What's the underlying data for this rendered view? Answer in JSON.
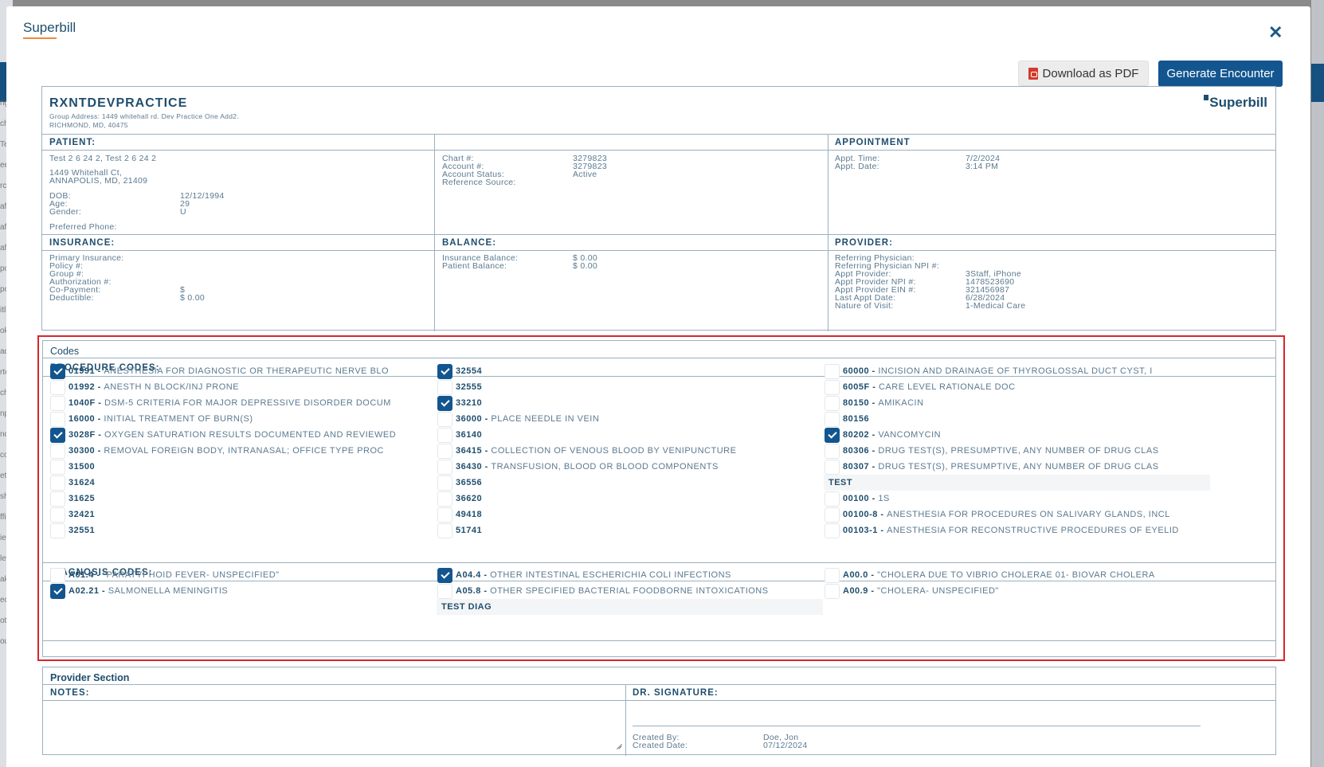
{
  "modal": {
    "title": "Superbill",
    "download_label": "Download as PDF",
    "generate_label": "Generate Encounter"
  },
  "bg": {
    "left_labels": [
      "ng",
      "chi,",
      "Tes",
      "eevi",
      "rco",
      "aff,",
      "aff,",
      "aff,",
      "pol",
      "pol",
      "itlis",
      "oke",
      "adi",
      "rte",
      "che",
      "npl",
      "ncel",
      "con",
      "ete",
      "sho",
      "ffir",
      "ient",
      "led",
      "ake",
      "eck",
      "otal",
      "oup"
    ]
  },
  "header": {
    "practice": "RXNTDEVPRACTICE",
    "address_line1": "Group Address: 1449 whitehall rd. Dev Practice One Add2.",
    "address_line2": "RICHMOND, MD, 40475",
    "logo": "Superbill"
  },
  "patient": {
    "heading": "PATIENT:",
    "name": "Test 2 6 24 2, Test 2 6 24 2",
    "street": "1449 Whitehall Ct,",
    "city": "ANNAPOLIS, MD, 21409",
    "dob_label": "DOB:",
    "dob": "12/12/1994",
    "age_label": "Age:",
    "age": "29",
    "gender_label": "Gender:",
    "gender": "U",
    "phone_label": "Preferred Phone:"
  },
  "account": {
    "chart_label": "Chart #:",
    "chart": "3279823",
    "account_label": "Account #:",
    "account": "3279823",
    "status_label": "Account Status:",
    "status": "Active",
    "ref_label": "Reference Source:"
  },
  "appointment": {
    "heading": "APPOINTMENT",
    "time_label": "Appt. Time:",
    "time": "7/2/2024",
    "date_label": "Appt. Date:",
    "date": "3:14 PM"
  },
  "insurance": {
    "heading": "INSURANCE:",
    "primary_label": "Primary Insurance:",
    "policy_label": "Policy #:",
    "group_label": "Group #:",
    "auth_label": "Authorization #:",
    "copay_label": "Co-Payment:",
    "copay": "$",
    "deductible_label": "Deductible:",
    "deductible": "$ 0.00"
  },
  "balance": {
    "heading": "BALANCE:",
    "ins_label": "Insurance Balance:",
    "ins": "$ 0.00",
    "pat_label": "Patient Balance:",
    "pat": "$ 0.00"
  },
  "provider": {
    "heading": "PROVIDER:",
    "ref_label": "Referring Physician:",
    "ref_npi_label": "Referring Physician NPI #:",
    "appt_label": "Appt Provider:",
    "appt": "3Staff, iPhone",
    "npi_label": "Appt Provider NPI #:",
    "npi": "1478523690",
    "ein_label": "Appt Provider EIN #:",
    "ein": "321456987",
    "last_label": "Last Appt Date:",
    "last": "6/28/2024",
    "nature_label": "Nature of Visit:",
    "nature": "1-Medical Care"
  },
  "codes": {
    "title": "Codes",
    "procedure_heading": "PROCEDURE CODES:",
    "diagnosis_heading": "DIAGNOSIS CODES:",
    "proc_col1": [
      {
        "code": "01991",
        "desc": "ANESTHESIA FOR DIAGNOSTIC OR THERAPEUTIC NERVE BLO",
        "checked": true
      },
      {
        "code": "01992",
        "desc": "ANESTH N BLOCK/INJ PRONE",
        "checked": false
      },
      {
        "code": "1040F",
        "desc": "DSM-5 CRITERIA FOR MAJOR DEPRESSIVE DISORDER DOCUM",
        "checked": false
      },
      {
        "code": "16000",
        "desc": "INITIAL TREATMENT OF BURN(S)",
        "checked": false
      },
      {
        "code": "3028F",
        "desc": "OXYGEN SATURATION RESULTS DOCUMENTED AND REVIEWED",
        "checked": true
      },
      {
        "code": "30300",
        "desc": "REMOVAL FOREIGN BODY, INTRANASAL; OFFICE TYPE PROC",
        "checked": false
      },
      {
        "code": "31500",
        "desc": "",
        "checked": false
      },
      {
        "code": "31624",
        "desc": "",
        "checked": false
      },
      {
        "code": "31625",
        "desc": "",
        "checked": false
      },
      {
        "code": "32421",
        "desc": "",
        "checked": false
      },
      {
        "code": "32551",
        "desc": "",
        "checked": false
      }
    ],
    "proc_col2": [
      {
        "code": "32554",
        "desc": "",
        "checked": true
      },
      {
        "code": "32555",
        "desc": "",
        "checked": false
      },
      {
        "code": "33210",
        "desc": "",
        "checked": true
      },
      {
        "code": "36000",
        "desc": "PLACE NEEDLE IN VEIN",
        "checked": false
      },
      {
        "code": "36140",
        "desc": "",
        "checked": false
      },
      {
        "code": "36415",
        "desc": "COLLECTION OF VENOUS BLOOD BY VENIPUNCTURE",
        "checked": false
      },
      {
        "code": "36430",
        "desc": "TRANSFUSION, BLOOD OR BLOOD COMPONENTS",
        "checked": false
      },
      {
        "code": "36556",
        "desc": "",
        "checked": false
      },
      {
        "code": "36620",
        "desc": "",
        "checked": false
      },
      {
        "code": "49418",
        "desc": "",
        "checked": false
      },
      {
        "code": "51741",
        "desc": "",
        "checked": false
      }
    ],
    "proc_col3": [
      {
        "code": "60000",
        "desc": "INCISION AND DRAINAGE OF THYROGLOSSAL DUCT CYST, I",
        "checked": false
      },
      {
        "code": "6005F",
        "desc": "CARE LEVEL RATIONALE DOC",
        "checked": false
      },
      {
        "code": "80150",
        "desc": "AMIKACIN",
        "checked": false
      },
      {
        "code": "80156",
        "desc": "",
        "checked": false
      },
      {
        "code": "80202",
        "desc": "VANCOMYCIN",
        "checked": true
      },
      {
        "code": "80306",
        "desc": "DRUG TEST(S), PRESUMPTIVE, ANY NUMBER OF DRUG CLAS",
        "checked": false
      },
      {
        "code": "80307",
        "desc": "DRUG TEST(S), PRESUMPTIVE, ANY NUMBER OF DRUG CLAS",
        "checked": false
      }
    ],
    "proc_group_label": "TEST",
    "proc_col3_group": [
      {
        "code": "00100",
        "desc": "1S",
        "checked": false
      },
      {
        "code": "00100-8",
        "desc": "ANESTHESIA FOR PROCEDURES ON SALIVARY GLANDS, INCL",
        "checked": false
      },
      {
        "code": "00103-1",
        "desc": "ANESTHESIA FOR RECONSTRUCTIVE PROCEDURES OF EYELID",
        "checked": false
      }
    ],
    "diag_col1": [
      {
        "code": "A01.4",
        "desc": "\"PARATYPHOID FEVER- UNSPECIFIED\"",
        "checked": false
      },
      {
        "code": "A02.21",
        "desc": "SALMONELLA MENINGITIS",
        "checked": true
      }
    ],
    "diag_col2": [
      {
        "code": "A04.4",
        "desc": "OTHER INTESTINAL ESCHERICHIA COLI INFECTIONS",
        "checked": true
      },
      {
        "code": "A05.8",
        "desc": "OTHER SPECIFIED BACTERIAL FOODBORNE INTOXICATIONS",
        "checked": false
      }
    ],
    "diag_group_label": "TEST DIAG",
    "diag_col3": [
      {
        "code": "A00.0",
        "desc": "\"CHOLERA DUE TO VIBRIO CHOLERAE 01- BIOVAR CHOLERA",
        "checked": false
      },
      {
        "code": "A00.9",
        "desc": "\"CHOLERA- UNSPECIFIED\"",
        "checked": false
      }
    ]
  },
  "provider_section": {
    "title": "Provider Section",
    "notes_heading": "NOTES:",
    "notes_value": "",
    "signature_heading": "DR. SIGNATURE:",
    "created_by_label": "Created By:",
    "created_by": "Doe, Jon",
    "created_date_label": "Created Date:",
    "created_date": "07/12/2024"
  },
  "colors": {
    "accent": "#13568f",
    "highlight": "#d8262d",
    "underline": "#f0883a"
  }
}
